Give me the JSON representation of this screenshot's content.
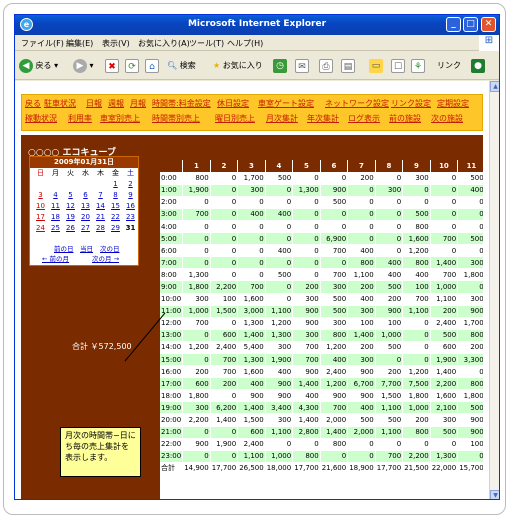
{
  "window": {
    "title": "Microsoft Internet Explorer"
  },
  "menu": [
    "ファイル(F)",
    "編集(E)",
    "表示(V)",
    "お気に入り(A)",
    "ツール(T)",
    "ヘルプ(H)"
  ],
  "toolbar": {
    "back": "戻る",
    "search": "検索",
    "favorites": "お気に入り",
    "links": "リンク"
  },
  "nav": {
    "row1": [
      "戻る",
      "駐車状況",
      "日報",
      "週報",
      "月報",
      "時間帯:料金設定",
      "休日設定",
      "車室ゲート設定",
      "ネットワーク設定",
      "リンク設定",
      "定期設定"
    ],
    "row2": [
      "稼動状況",
      "利用率",
      "車室別売上",
      "時間帯別売上",
      "曜日別売上",
      "月次集計",
      "年次集計",
      "ログ表示",
      "前の施設",
      "次の施設"
    ]
  },
  "brand": "○○○○ エコキューブ",
  "calendar": {
    "title": "2009年01月31日",
    "weekdays": [
      "日",
      "月",
      "火",
      "水",
      "木",
      "金",
      "土"
    ],
    "weeks": [
      [
        "",
        "",
        "",
        "",
        "",
        "1",
        "2"
      ],
      [
        "3",
        "4",
        "5",
        "6",
        "7",
        "8",
        "9"
      ],
      [
        "10",
        "11",
        "12",
        "13",
        "14",
        "15",
        "16"
      ],
      [
        "17",
        "18",
        "19",
        "20",
        "21",
        "22",
        "23"
      ],
      [
        "24",
        "25",
        "26",
        "27",
        "28",
        "29",
        "31"
      ]
    ],
    "links": {
      "prev_day": "前の日",
      "today": "当日",
      "next_day": "次の日",
      "prev_month": "← 前の月",
      "next_month": "次の月 →"
    }
  },
  "total": "合計 ￥572,500",
  "table": {
    "columns": [
      "",
      "1",
      "2",
      "3",
      "4",
      "5",
      "6",
      "7",
      "8",
      "9",
      "10",
      "11",
      "12",
      "13"
    ],
    "rows": [
      [
        "0:00",
        "800",
        "0",
        "1,700",
        "500",
        "0",
        "0",
        "200",
        "0",
        "300",
        "0",
        "500",
        "0",
        "0"
      ],
      [
        "1:00",
        "1,900",
        "0",
        "300",
        "0",
        "1,300",
        "900",
        "0",
        "300",
        "0",
        "0",
        "400",
        "0",
        "0"
      ],
      [
        "2:00",
        "0",
        "0",
        "0",
        "0",
        "0",
        "500",
        "0",
        "0",
        "0",
        "0",
        "0",
        "0",
        "700"
      ],
      [
        "3:00",
        "700",
        "0",
        "400",
        "400",
        "0",
        "0",
        "0",
        "0",
        "500",
        "0",
        "0",
        "400",
        "0"
      ],
      [
        "4:00",
        "0",
        "0",
        "0",
        "0",
        "0",
        "0",
        "0",
        "0",
        "800",
        "0",
        "0",
        "0",
        "0"
      ],
      [
        "5:00",
        "0",
        "0",
        "0",
        "0",
        "0",
        "6,900",
        "0",
        "0",
        "1,600",
        "700",
        "500",
        "0",
        "600"
      ],
      [
        "6:00",
        "0",
        "0",
        "0",
        "400",
        "0",
        "700",
        "400",
        "0",
        "1,200",
        "0",
        "0",
        "0",
        "0"
      ],
      [
        "7:00",
        "0",
        "0",
        "0",
        "0",
        "0",
        "0",
        "800",
        "400",
        "800",
        "1,400",
        "300",
        "800",
        "0"
      ],
      [
        "8:00",
        "1,300",
        "0",
        "0",
        "500",
        "0",
        "700",
        "1,100",
        "400",
        "400",
        "700",
        "1,800",
        "200",
        "500"
      ],
      [
        "9:00",
        "1,800",
        "2,200",
        "700",
        "0",
        "200",
        "300",
        "200",
        "500",
        "100",
        "1,000",
        "0",
        "100",
        "0"
      ],
      [
        "10:00",
        "300",
        "100",
        "1,600",
        "0",
        "300",
        "500",
        "400",
        "200",
        "700",
        "1,100",
        "300",
        "300",
        "200"
      ],
      [
        "11:00",
        "1,000",
        "1,500",
        "3,000",
        "1,100",
        "900",
        "500",
        "300",
        "900",
        "1,100",
        "200",
        "900",
        "400",
        "1,500"
      ],
      [
        "12:00",
        "700",
        "0",
        "1,300",
        "1,200",
        "900",
        "300",
        "100",
        "100",
        "0",
        "2,400",
        "1,700",
        "500",
        "500"
      ],
      [
        "13:00",
        "0",
        "600",
        "1,400",
        "1,300",
        "300",
        "800",
        "1,400",
        "1,000",
        "0",
        "500",
        "800",
        "100",
        "200"
      ],
      [
        "14:00",
        "1,200",
        "2,400",
        "5,400",
        "300",
        "700",
        "1,200",
        "200",
        "500",
        "0",
        "600",
        "200",
        "1,000",
        "200"
      ],
      [
        "15:00",
        "0",
        "700",
        "1,300",
        "1,900",
        "700",
        "400",
        "300",
        "0",
        "0",
        "1,900",
        "3,300",
        "0",
        "300"
      ],
      [
        "16:00",
        "200",
        "700",
        "1,600",
        "400",
        "900",
        "2,400",
        "900",
        "200",
        "1,200",
        "1,400",
        "0",
        "1,800",
        "1,000"
      ],
      [
        "17:00",
        "600",
        "200",
        "400",
        "900",
        "1,400",
        "1,200",
        "6,700",
        "7,700",
        "7,500",
        "2,200",
        "800",
        "3,400",
        "5,300"
      ],
      [
        "18:00",
        "1,800",
        "0",
        "900",
        "900",
        "400",
        "900",
        "900",
        "1,500",
        "1,800",
        "1,600",
        "1,800",
        "3,500",
        "1,200"
      ],
      [
        "19:00",
        "300",
        "6,200",
        "1,400",
        "3,400",
        "4,300",
        "700",
        "400",
        "1,100",
        "1,000",
        "2,100",
        "500",
        "2,300",
        "900"
      ],
      [
        "20:00",
        "2,200",
        "1,400",
        "1,500",
        "300",
        "1,400",
        "2,000",
        "500",
        "500",
        "200",
        "300",
        "900",
        "1,400",
        "2,000"
      ],
      [
        "21:00",
        "0",
        "0",
        "600",
        "1,100",
        "2,800",
        "1,400",
        "2,000",
        "1,100",
        "800",
        "500",
        "900",
        "400",
        "1,500"
      ],
      [
        "22:00",
        "900",
        "1,900",
        "2,400",
        "0",
        "0",
        "800",
        "0",
        "0",
        "0",
        "0",
        "100",
        "0",
        "0"
      ],
      [
        "23:00",
        "0",
        "0",
        "1,100",
        "1,000",
        "800",
        "0",
        "0",
        "700",
        "2,200",
        "1,300",
        "0",
        "0",
        "0"
      ]
    ],
    "totals": [
      "合計",
      "14,900",
      "17,700",
      "26,500",
      "18,000",
      "17,700",
      "21,600",
      "18,900",
      "17,700",
      "21,500",
      "22,000",
      "15,700",
      "16,600",
      "16,700",
      "21"
    ]
  },
  "tooltip": "月次の時間帯−日にち毎の売上集計を表示します。",
  "colors": {
    "nav_bg": "#ffc629",
    "main_bg": "#7a2b00",
    "row_alt": "#ccffcc",
    "tooltip_bg": "#ffff99"
  }
}
